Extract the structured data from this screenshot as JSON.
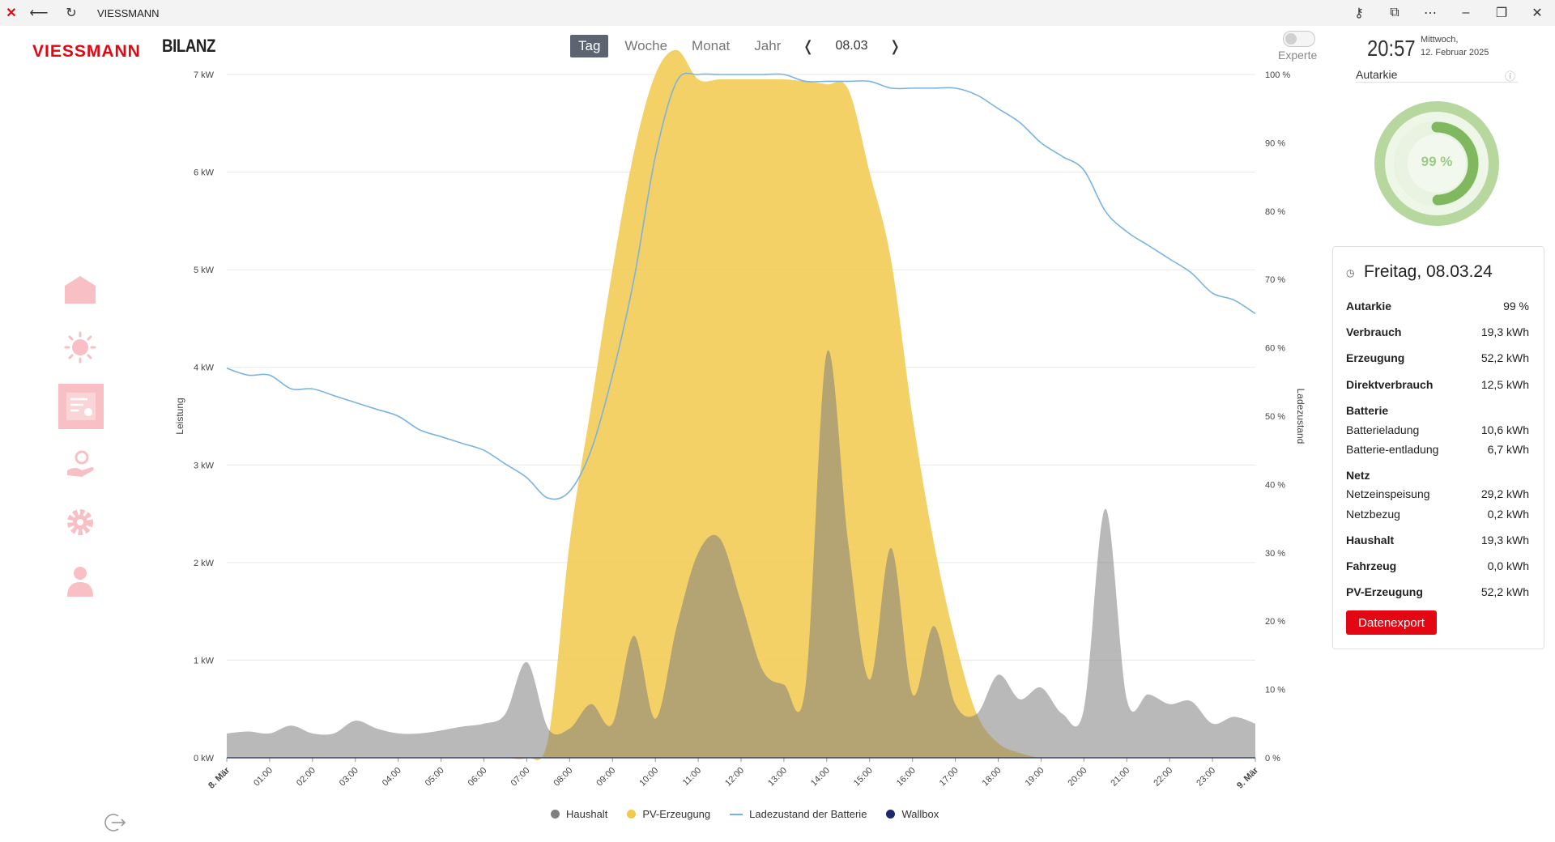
{
  "window": {
    "title": "VIESSMANN",
    "icons": [
      "app-icon",
      "back-icon",
      "refresh-icon",
      "key-icon",
      "cast-icon",
      "more-icon",
      "minimize-icon",
      "restore-icon",
      "close-icon"
    ]
  },
  "brand": {
    "logo_text": "VIESSMANN",
    "color": "#e30613"
  },
  "page": {
    "title": "BILANZ"
  },
  "sidebar": {
    "items": [
      {
        "name": "home-icon"
      },
      {
        "name": "sun-icon"
      },
      {
        "name": "report-icon",
        "active": true
      },
      {
        "name": "hand-coin-icon"
      },
      {
        "name": "gear-icon"
      },
      {
        "name": "user-icon"
      }
    ],
    "logout": "logout-icon"
  },
  "tabs": [
    {
      "label": "Tag",
      "active": true
    },
    {
      "label": "Woche"
    },
    {
      "label": "Monat"
    },
    {
      "label": "Jahr"
    }
  ],
  "date_nav": {
    "prev": "❬",
    "value": "08.03",
    "next": "❭"
  },
  "expert": {
    "label": "Experte",
    "enabled": false
  },
  "clock": {
    "time": "20:57",
    "weekday": "Mittwoch,",
    "date": "12. Februar 2025"
  },
  "autarkie_widget": {
    "label": "Autarkie",
    "value": "99 %",
    "fraction": 0.99
  },
  "summary": {
    "title": "Freitag, 08.03.24",
    "rows": [
      {
        "label": "Autarkie",
        "value": "99 %"
      },
      {
        "label": "Verbrauch",
        "value": "19,3 kWh"
      },
      {
        "label": "Erzeugung",
        "value": "52,2 kWh"
      },
      {
        "label": "Direktverbrauch",
        "value": "12,5 kWh"
      }
    ],
    "battery": {
      "heading": "Batterie",
      "rows": [
        {
          "label": "Batterieladung",
          "value": "10,6 kWh"
        },
        {
          "label": "Batterie-entladung",
          "value": "6,7 kWh"
        }
      ]
    },
    "grid": {
      "heading": "Netz",
      "rows": [
        {
          "label": "Netzeinspeisung",
          "value": "29,2 kWh"
        },
        {
          "label": "Netzbezug",
          "value": "0,2 kWh"
        }
      ]
    },
    "totals": [
      {
        "label": "Haushalt",
        "value": "19,3 kWh"
      },
      {
        "label": "Fahrzeug",
        "value": "0,0 kWh"
      },
      {
        "label": "PV-Erzeugung",
        "value": "52,2 kWh"
      }
    ],
    "export_label": "Datenexport"
  },
  "chart_data": {
    "type": "area",
    "xlabel": "",
    "ylabel": "Leistung",
    "y2label": "Ladezustand",
    "ylim": [
      0,
      7
    ],
    "y2lim": [
      0,
      100
    ],
    "ytick_labels": [
      "0 kW",
      "1 kW",
      "2 kW",
      "3 kW",
      "4 kW",
      "5 kW",
      "6 kW",
      "7 kW"
    ],
    "y2tick_labels": [
      "0 %",
      "10 %",
      "20 %",
      "30 %",
      "40 %",
      "50 %",
      "60 %",
      "70 %",
      "80 %",
      "90 %",
      "100 %"
    ],
    "xtick_labels": [
      "8. Mär",
      "01:00",
      "02:00",
      "03:00",
      "04:00",
      "05:00",
      "06:00",
      "07:00",
      "08:00",
      "09:00",
      "10:00",
      "11:00",
      "12:00",
      "13:00",
      "14:00",
      "15:00",
      "16:00",
      "17:00",
      "18:00",
      "19:00",
      "20:00",
      "21:00",
      "22:00",
      "23:00",
      "9. Mär"
    ],
    "x_hours": [
      0,
      0.5,
      1,
      1.5,
      2,
      2.5,
      3,
      3.5,
      4,
      4.5,
      5,
      5.5,
      6,
      6.5,
      7,
      7.5,
      8,
      8.5,
      9,
      9.5,
      10,
      10.5,
      11,
      11.5,
      12,
      12.5,
      13,
      13.5,
      14,
      14.5,
      15,
      15.5,
      16,
      16.5,
      17,
      17.5,
      18,
      18.5,
      19,
      19.5,
      20,
      20.5,
      21,
      21.5,
      22,
      22.5,
      23,
      23.5,
      24
    ],
    "series": [
      {
        "name": "Haushalt",
        "color": "#808080",
        "kind": "area",
        "values": [
          0.25,
          0.27,
          0.25,
          0.33,
          0.25,
          0.25,
          0.38,
          0.3,
          0.25,
          0.25,
          0.28,
          0.32,
          0.35,
          0.45,
          0.98,
          0.3,
          0.3,
          0.55,
          0.35,
          1.25,
          0.4,
          1.35,
          2.1,
          2.25,
          1.6,
          0.9,
          0.75,
          0.72,
          4.15,
          2.2,
          0.8,
          2.15,
          0.65,
          1.35,
          0.55,
          0.45,
          0.85,
          0.6,
          0.72,
          0.45,
          0.5,
          2.55,
          0.6,
          0.65,
          0.55,
          0.58,
          0.35,
          0.42,
          0.35
        ]
      },
      {
        "name": "PV-Erzeugung",
        "color": "#f2c94c",
        "kind": "area",
        "values": [
          0,
          0,
          0,
          0,
          0,
          0,
          0,
          0,
          0,
          0,
          0,
          0,
          0,
          0,
          0,
          0.2,
          2.2,
          3.6,
          5.0,
          6.2,
          7.0,
          7.25,
          6.95,
          6.95,
          6.95,
          6.95,
          6.95,
          6.93,
          6.9,
          6.85,
          6.0,
          5.1,
          3.5,
          2.2,
          1.2,
          0.45,
          0.15,
          0.05,
          0,
          0,
          0,
          0,
          0,
          0,
          0,
          0,
          0,
          0,
          0
        ]
      },
      {
        "name": "Ladezustand der Batterie",
        "color": "#7ab3e0",
        "kind": "line",
        "values": [
          57,
          56,
          56,
          54,
          54,
          53,
          52,
          51,
          50,
          48,
          47,
          46,
          45,
          43,
          41,
          38,
          39,
          45,
          56,
          70,
          88,
          99,
          100,
          100,
          100,
          100,
          100,
          99,
          99,
          99,
          99,
          98,
          98,
          98,
          98,
          97,
          95,
          93,
          90,
          88,
          86,
          80,
          77,
          75,
          73,
          71,
          68,
          67,
          65
        ]
      },
      {
        "name": "Wallbox",
        "color": "#1c2a6b",
        "kind": "line",
        "values": [
          0,
          0,
          0,
          0,
          0,
          0,
          0,
          0,
          0,
          0,
          0,
          0,
          0,
          0,
          0,
          0,
          0,
          0,
          0,
          0,
          0,
          0,
          0,
          0,
          0,
          0,
          0,
          0,
          0,
          0,
          0,
          0,
          0,
          0,
          0,
          0,
          0,
          0,
          0,
          0,
          0,
          0,
          0,
          0,
          0,
          0,
          0,
          0,
          0
        ]
      }
    ],
    "legend_position": "bottom",
    "grid": true
  }
}
